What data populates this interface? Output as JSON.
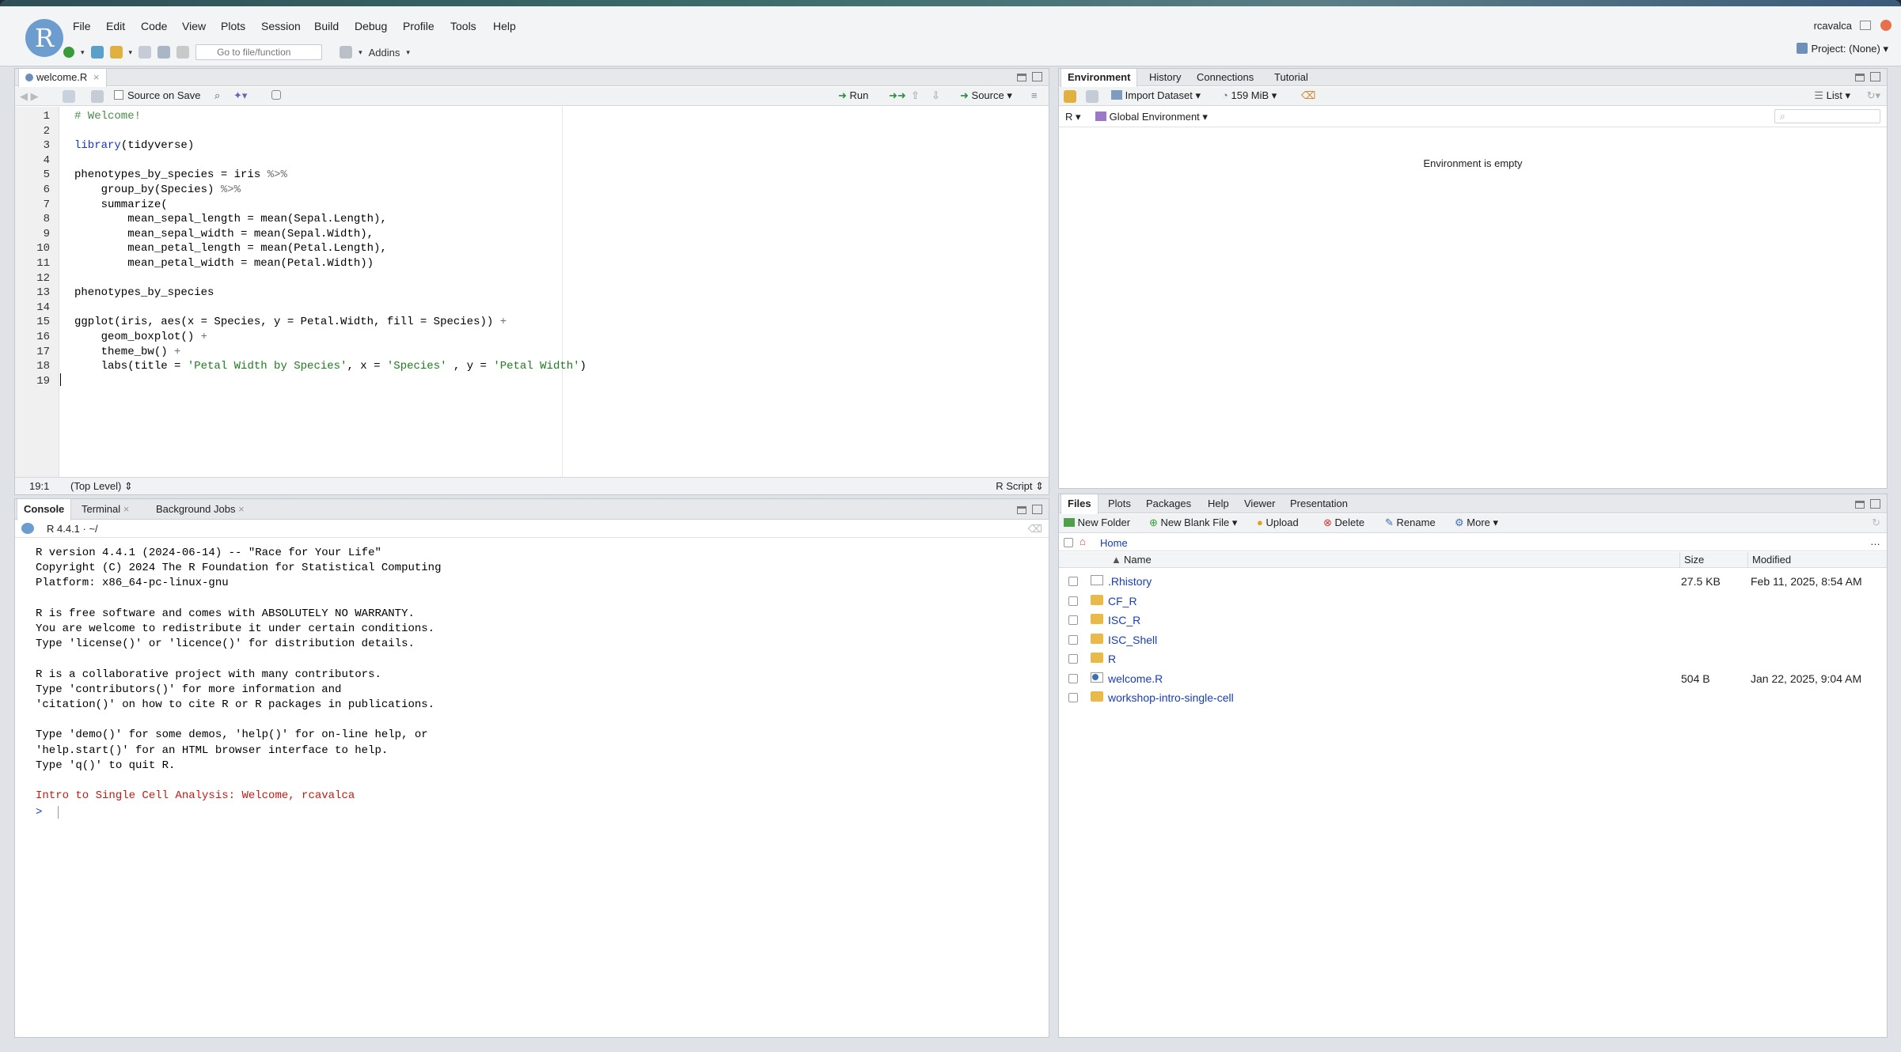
{
  "menu": [
    "File",
    "Edit",
    "Code",
    "View",
    "Plots",
    "Session",
    "Build",
    "Debug",
    "Profile",
    "Tools",
    "Help"
  ],
  "user": "rcavalca",
  "project": "Project: (None)",
  "toolbar": {
    "goto_placeholder": "Go to file/function",
    "addins": "Addins"
  },
  "editor": {
    "tab": "welcome.R",
    "source_on_save": "Source on Save",
    "run": "Run",
    "source": "Source",
    "position": "19:1",
    "scope": "(Top Level)",
    "filetype": "R Script",
    "lines": [
      [
        [
          "cm",
          "# Welcome!"
        ]
      ],
      [],
      [
        [
          "kw",
          "library"
        ],
        [
          "n",
          "(tidyverse)"
        ]
      ],
      [],
      [
        [
          "n",
          "phenotypes_by_species = iris "
        ],
        [
          "op",
          "%>%"
        ]
      ],
      [
        [
          "n",
          "    group_by(Species) "
        ],
        [
          "op",
          "%>%"
        ]
      ],
      [
        [
          "n",
          "    summarize("
        ]
      ],
      [
        [
          "n",
          "        mean_sepal_length = mean(Sepal.Length),"
        ]
      ],
      [
        [
          "n",
          "        mean_sepal_width = mean(Sepal.Width),"
        ]
      ],
      [
        [
          "n",
          "        mean_petal_length = mean(Petal.Length),"
        ]
      ],
      [
        [
          "n",
          "        mean_petal_width = mean(Petal.Width))"
        ]
      ],
      [],
      [
        [
          "n",
          "phenotypes_by_species"
        ]
      ],
      [],
      [
        [
          "n",
          "ggplot(iris, aes(x = Species, y = Petal.Width, fill = Species)) "
        ],
        [
          "op",
          "+"
        ]
      ],
      [
        [
          "n",
          "    geom_boxplot() "
        ],
        [
          "op",
          "+"
        ]
      ],
      [
        [
          "n",
          "    theme_bw() "
        ],
        [
          "op",
          "+"
        ]
      ],
      [
        [
          "n",
          "    labs(title = "
        ],
        [
          "st",
          "'Petal Width by Species'"
        ],
        [
          "n",
          ", x = "
        ],
        [
          "st",
          "'Species'"
        ],
        [
          "n",
          " , y = "
        ],
        [
          "st",
          "'Petal Width'"
        ],
        [
          "n",
          ")"
        ]
      ],
      []
    ]
  },
  "console": {
    "tabs": [
      "Console",
      "Terminal",
      "Background Jobs"
    ],
    "rversion": "R 4.4.1 · ~/",
    "lines": [
      "R version 4.4.1 (2024-06-14) -- \"Race for Your Life\"",
      "Copyright (C) 2024 The R Foundation for Statistical Computing",
      "Platform: x86_64-pc-linux-gnu",
      "",
      "R is free software and comes with ABSOLUTELY NO WARRANTY.",
      "You are welcome to redistribute it under certain conditions.",
      "Type 'license()' or 'licence()' for distribution details.",
      "",
      "R is a collaborative project with many contributors.",
      "Type 'contributors()' for more information and",
      "'citation()' on how to cite R or R packages in publications.",
      "",
      "Type 'demo()' for some demos, 'help()' for on-line help, or",
      "'help.start()' for an HTML browser interface to help.",
      "Type 'q()' to quit R."
    ],
    "welcome": "Intro to Single Cell Analysis: Welcome, rcavalca",
    "prompt": ">"
  },
  "environment": {
    "tabs": [
      "Environment",
      "History",
      "Connections",
      "Tutorial"
    ],
    "import": "Import Dataset",
    "memory": "159 MiB",
    "list": "List",
    "lang": "R",
    "scope": "Global Environment",
    "empty": "Environment is empty"
  },
  "files": {
    "tabs": [
      "Files",
      "Plots",
      "Packages",
      "Help",
      "Viewer",
      "Presentation"
    ],
    "actions": [
      "New Folder",
      "New Blank File",
      "Upload",
      "Delete",
      "Rename",
      "More"
    ],
    "breadcrumb": "Home",
    "columns": [
      "Name",
      "Size",
      "Modified"
    ],
    "rows": [
      {
        "name": ".Rhistory",
        "size": "27.5 KB",
        "mod": "Feb 11, 2025, 8:54 AM",
        "type": "file"
      },
      {
        "name": "CF_R",
        "size": "",
        "mod": "",
        "type": "folder"
      },
      {
        "name": "ISC_R",
        "size": "",
        "mod": "",
        "type": "folder"
      },
      {
        "name": "ISC_Shell",
        "size": "",
        "mod": "",
        "type": "folder"
      },
      {
        "name": "R",
        "size": "",
        "mod": "",
        "type": "folder"
      },
      {
        "name": "welcome.R",
        "size": "504 B",
        "mod": "Jan 22, 2025, 9:04 AM",
        "type": "rfile"
      },
      {
        "name": "workshop-intro-single-cell",
        "size": "",
        "mod": "",
        "type": "folder"
      }
    ]
  },
  "colors": {
    "accent": "#1a3db5",
    "welcome": "#c41a16",
    "logo": "#6d9ccf"
  }
}
